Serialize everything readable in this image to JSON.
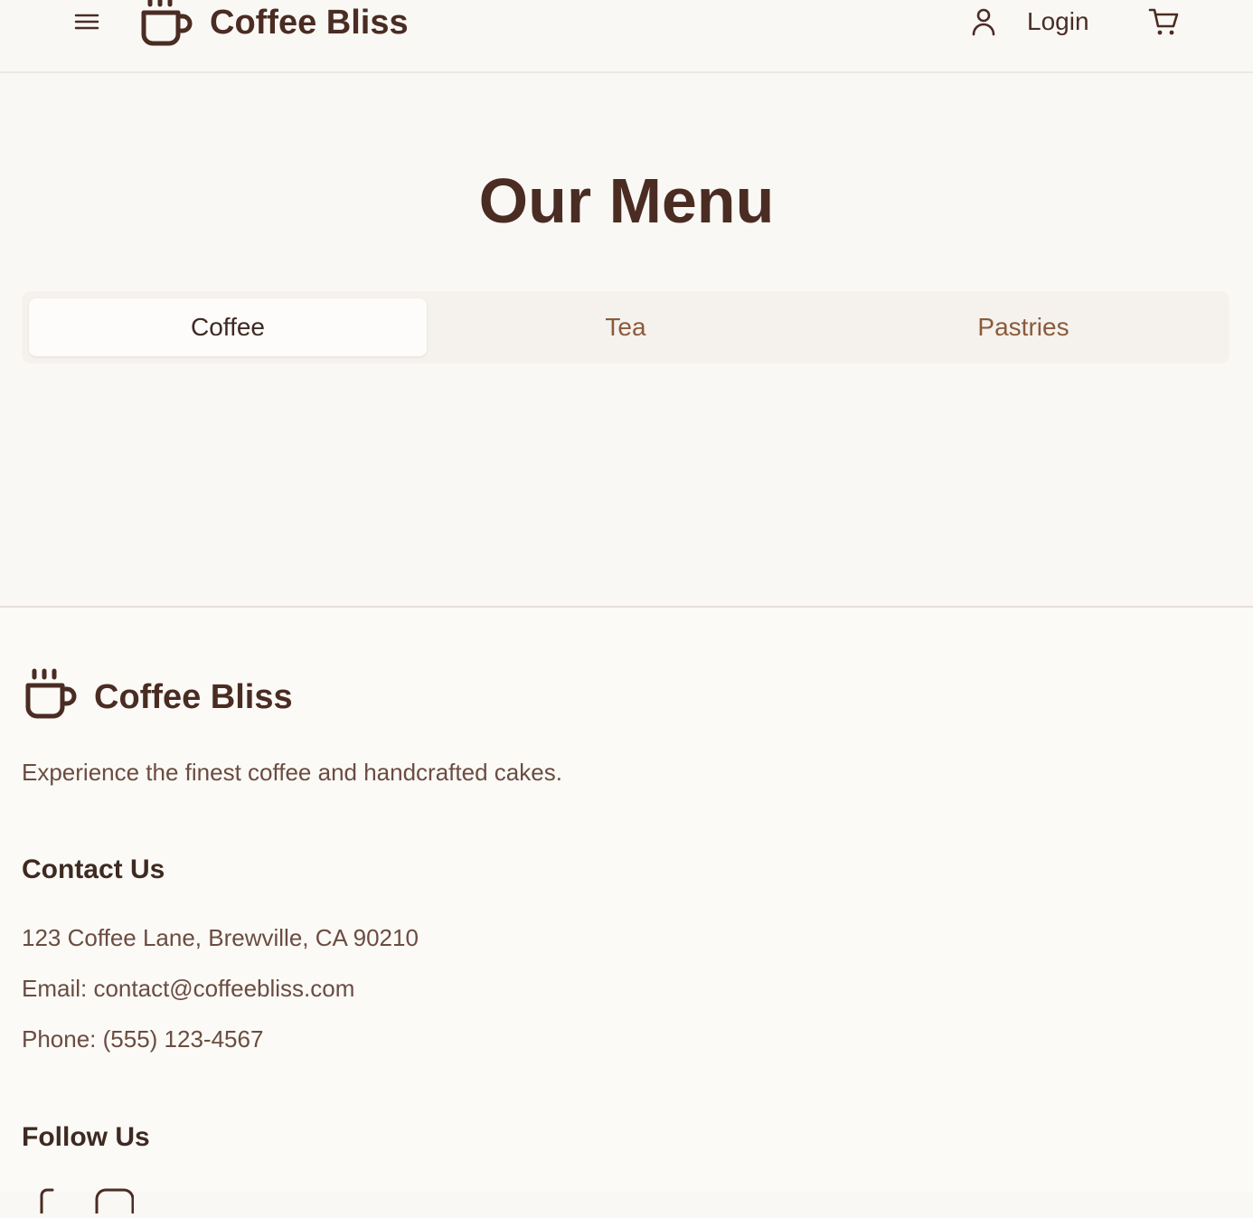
{
  "header": {
    "menu_icon": "menu-icon",
    "logo_icon": "coffee-cup-icon",
    "brand": "Coffee Bliss",
    "user_icon": "user-icon",
    "login_label": "Login",
    "cart_icon": "cart-icon"
  },
  "main": {
    "title": "Our Menu",
    "tabs": [
      {
        "label": "Coffee",
        "active": true
      },
      {
        "label": "Tea",
        "active": false
      },
      {
        "label": "Pastries",
        "active": false
      }
    ]
  },
  "footer": {
    "logo_icon": "coffee-cup-icon",
    "brand": "Coffee Bliss",
    "tagline": "Experience the finest coffee and handcrafted cakes.",
    "contact_heading": "Contact Us",
    "address": "123 Coffee Lane, Brewville, CA 90210",
    "email": "Email: contact@coffeebliss.com",
    "phone": "Phone: (555) 123-4567",
    "follow_heading": "Follow Us",
    "social_icons": [
      "facebook-icon",
      "instagram-icon"
    ]
  },
  "colors": {
    "background": "#faf8f5",
    "text_dark": "#4a2c23",
    "tab_inactive": "#8b5a3c",
    "body_text": "#6b4c40"
  }
}
